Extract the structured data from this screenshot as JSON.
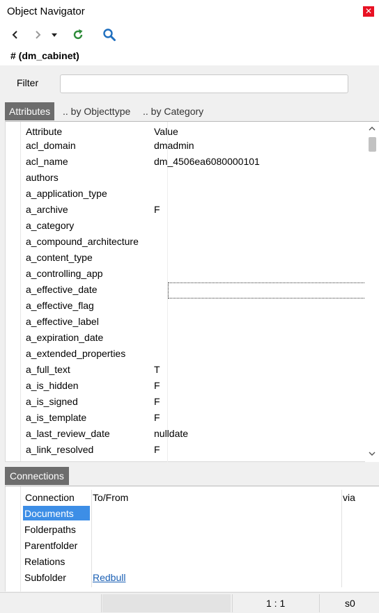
{
  "window": {
    "title": "Object Navigator",
    "close_glyph": "✕"
  },
  "toolbar": {
    "back_icon": "chevron-left-icon",
    "forward_icon": "chevron-right-icon",
    "dropdown_icon": "caret-down-icon",
    "refresh_icon": "refresh-icon",
    "search_icon": "search-icon",
    "refresh_color": "#2e8b3a",
    "search_color": "#1f6fbf"
  },
  "object": {
    "name": "# (dm_cabinet)"
  },
  "filter": {
    "label": "Filter",
    "value": ""
  },
  "tabs": [
    {
      "label": "Attributes",
      "active": true
    },
    {
      "label": ".. by Objecttype",
      "active": false
    },
    {
      "label": ".. by Category",
      "active": false
    }
  ],
  "attributes": {
    "headers": {
      "attribute": "Attribute",
      "value": "Value"
    },
    "rows": [
      {
        "attribute": "acl_domain",
        "value": "dmadmin"
      },
      {
        "attribute": "acl_name",
        "value": "dm_4506ea6080000101"
      },
      {
        "attribute": "authors",
        "value": ""
      },
      {
        "attribute": "a_application_type",
        "value": ""
      },
      {
        "attribute": "a_archive",
        "value": "F"
      },
      {
        "attribute": "a_category",
        "value": ""
      },
      {
        "attribute": "a_compound_architecture",
        "value": ""
      },
      {
        "attribute": "a_content_type",
        "value": ""
      },
      {
        "attribute": "a_controlling_app",
        "value": ""
      },
      {
        "attribute": "a_effective_date",
        "value": ""
      },
      {
        "attribute": "a_effective_flag",
        "value": ""
      },
      {
        "attribute": "a_effective_label",
        "value": ""
      },
      {
        "attribute": "a_expiration_date",
        "value": ""
      },
      {
        "attribute": "a_extended_properties",
        "value": ""
      },
      {
        "attribute": "a_full_text",
        "value": "T"
      },
      {
        "attribute": "a_is_hidden",
        "value": "F"
      },
      {
        "attribute": "a_is_signed",
        "value": "F"
      },
      {
        "attribute": "a_is_template",
        "value": "F"
      },
      {
        "attribute": "a_last_review_date",
        "value": "nulldate"
      },
      {
        "attribute": "a_link_resolved",
        "value": "F"
      }
    ]
  },
  "connections": {
    "tab_label": "Connections",
    "headers": {
      "connection": "Connection",
      "tofrom": "To/From",
      "via": "via"
    },
    "rows": [
      {
        "connection": "Documents",
        "tofrom": "",
        "selected": true
      },
      {
        "connection": "Folderpaths",
        "tofrom": ""
      },
      {
        "connection": "Parentfolder",
        "tofrom": ""
      },
      {
        "connection": "Relations",
        "tofrom": ""
      },
      {
        "connection": "Subfolder",
        "tofrom": "Redbull"
      }
    ]
  },
  "status": {
    "position": "1 : 1",
    "session": "s0"
  }
}
